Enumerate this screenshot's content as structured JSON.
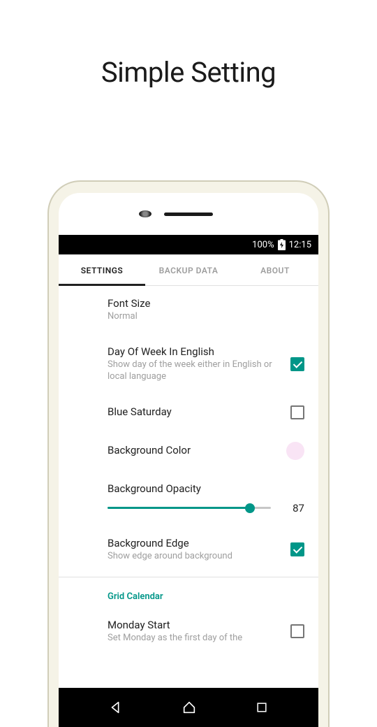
{
  "page_title": "Simple Setting",
  "status": {
    "battery_pct": "100%",
    "time": "12:15"
  },
  "tabs": [
    {
      "label": "SETTINGS",
      "active": true
    },
    {
      "label": "BACKUP DATA",
      "active": false
    },
    {
      "label": "ABOUT",
      "active": false
    }
  ],
  "settings": {
    "font_size": {
      "title": "Font Size",
      "value": "Normal"
    },
    "dow_english": {
      "title": "Day Of Week In English",
      "desc": "Show day of the week either in English or local language",
      "checked": true
    },
    "blue_saturday": {
      "title": "Blue Saturday",
      "checked": false
    },
    "bg_color": {
      "title": "Background Color",
      "color": "#f9e4f5"
    },
    "bg_opacity": {
      "title": "Background Opacity",
      "value": "87"
    },
    "bg_edge": {
      "title": "Background Edge",
      "desc": "Show edge around background",
      "checked": true
    }
  },
  "section_header": "Grid Calendar",
  "monday_start": {
    "title": "Monday Start",
    "desc": "Set Monday as the first day of the",
    "checked": false
  },
  "colors": {
    "accent": "#009688"
  }
}
